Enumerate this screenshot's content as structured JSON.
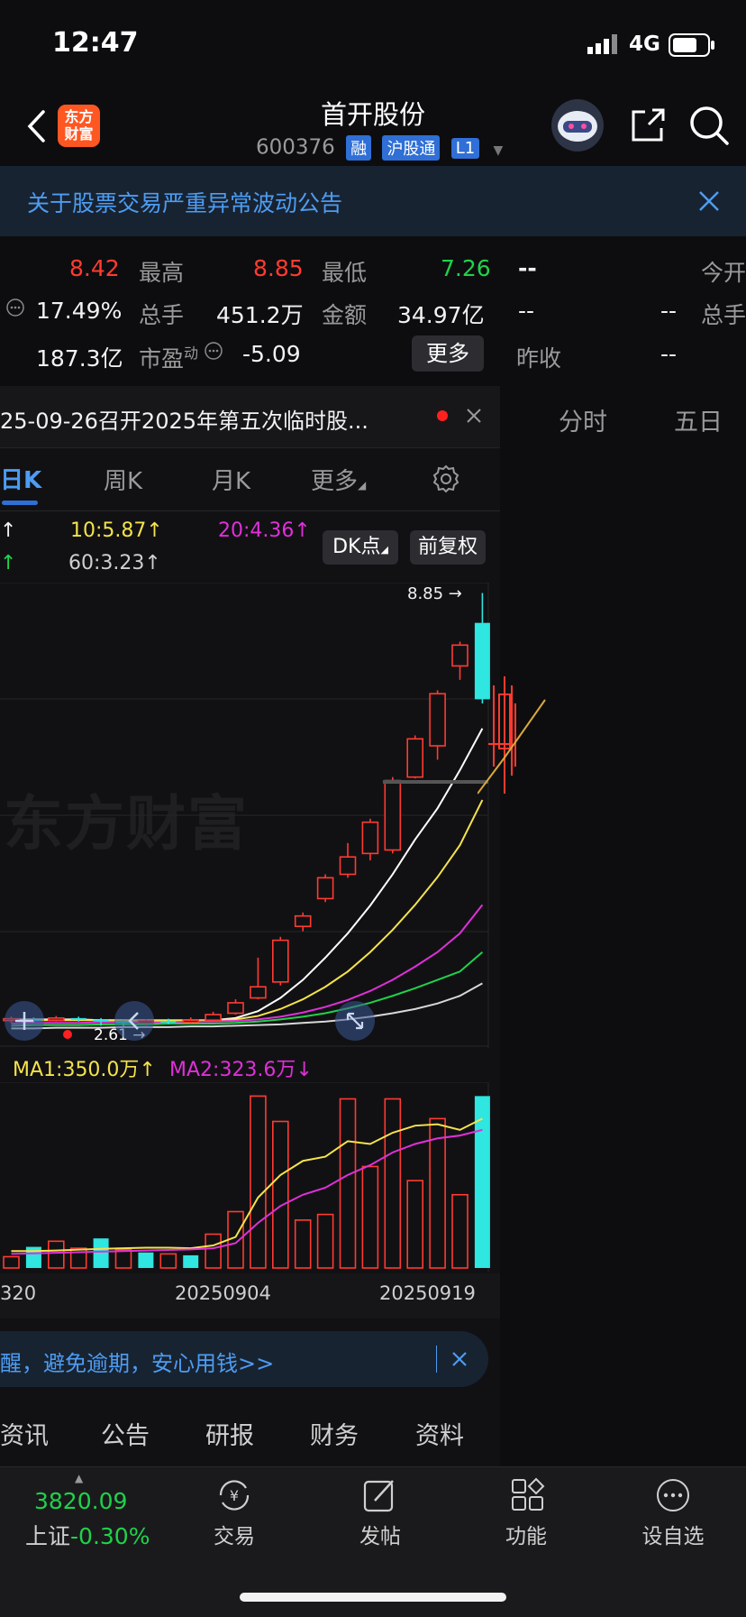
{
  "status_bar": {
    "time": "12:47",
    "network": "4G"
  },
  "header": {
    "logo_text": "东方\n财富",
    "title": "首开股份",
    "code": "600376",
    "badges": [
      "融",
      "沪股通",
      "L1"
    ]
  },
  "notice": {
    "text": "关于股票交易严重异常波动公告"
  },
  "quote": {
    "row1": {
      "v1": "8.42",
      "l2": "最高",
      "v2": "8.85",
      "l3": "最低",
      "v3": "7.26",
      "v4": "--",
      "l5": "今开"
    },
    "row2": {
      "v1": "17.49%",
      "l2": "总手",
      "v2": "451.2万",
      "l3": "金额",
      "v3": "34.97亿",
      "v4": "--",
      "v5": "--",
      "l6": "总手"
    },
    "row3": {
      "v1": "187.3亿",
      "l2": "市盈",
      "l2_sup": "动",
      "v2": "-5.09",
      "more": "更多",
      "l4": "昨收",
      "v4": "--"
    }
  },
  "event": {
    "text": "25-09-26召开2025年第五次临时股..."
  },
  "right_tabs": [
    "分时",
    "五日"
  ],
  "period_tabs": [
    "日K",
    "周K",
    "月K",
    "更多"
  ],
  "ma_legend": {
    "ma10": "10:5.87",
    "ma20": "20:4.36",
    "ma60": "60:3.23",
    "arrow_up": "↑"
  },
  "chart_buttons": {
    "dk": "DK点",
    "adj": "前复权"
  },
  "watermark": "东方财富",
  "kline_labels": {
    "high": "8.85",
    "low": "2.61"
  },
  "volume_legend": {
    "ma1": "MA1:350.0万",
    "ma1_arrow": "↑",
    "ma2": "MA2:323.6万",
    "ma2_arrow": "↓"
  },
  "date_axis": [
    "320",
    "20250904",
    "20250919"
  ],
  "banner": {
    "text": "醒，避免逾期，安心用钱>>"
  },
  "info_tabs": [
    "资讯",
    "公告",
    "研报",
    "财务",
    "资料"
  ],
  "bottom_nav": {
    "index_value": "3820.09",
    "index_name": "上证",
    "index_change": "-0.30%",
    "items": [
      "交易",
      "发帖",
      "功能",
      "设自选"
    ]
  },
  "chart_data": {
    "type": "candlestick",
    "price_range": [
      2.3,
      9.0
    ],
    "candles": [
      {
        "o": 2.7,
        "c": 2.72,
        "h": 2.75,
        "l": 2.66,
        "up": true
      },
      {
        "o": 2.71,
        "c": 2.7,
        "h": 2.74,
        "l": 2.67,
        "up": false
      },
      {
        "o": 2.7,
        "c": 2.73,
        "h": 2.76,
        "l": 2.68,
        "up": true
      },
      {
        "o": 2.73,
        "c": 2.71,
        "h": 2.75,
        "l": 2.68,
        "up": false
      },
      {
        "o": 2.71,
        "c": 2.68,
        "h": 2.73,
        "l": 2.62,
        "up": false
      },
      {
        "o": 2.68,
        "c": 2.66,
        "h": 2.7,
        "l": 2.61,
        "up": false
      },
      {
        "o": 2.66,
        "c": 2.69,
        "h": 2.71,
        "l": 2.62,
        "up": true
      },
      {
        "o": 2.69,
        "c": 2.67,
        "h": 2.72,
        "l": 2.64,
        "up": false
      },
      {
        "o": 2.67,
        "c": 2.7,
        "h": 2.74,
        "l": 2.65,
        "up": true
      },
      {
        "o": 2.7,
        "c": 2.78,
        "h": 2.82,
        "l": 2.69,
        "up": true
      },
      {
        "o": 2.8,
        "c": 2.95,
        "h": 3.0,
        "l": 2.78,
        "up": true
      },
      {
        "o": 3.02,
        "c": 3.18,
        "h": 3.6,
        "l": 3.0,
        "up": true
      },
      {
        "o": 3.25,
        "c": 3.85,
        "h": 3.9,
        "l": 3.2,
        "up": true
      },
      {
        "o": 4.05,
        "c": 4.2,
        "h": 4.25,
        "l": 3.98,
        "up": true
      },
      {
        "o": 4.45,
        "c": 4.75,
        "h": 4.8,
        "l": 4.4,
        "up": true
      },
      {
        "o": 4.8,
        "c": 5.05,
        "h": 5.25,
        "l": 4.75,
        "up": true
      },
      {
        "o": 5.1,
        "c": 5.55,
        "h": 5.6,
        "l": 5.0,
        "up": true
      },
      {
        "o": 5.15,
        "c": 6.15,
        "h": 6.2,
        "l": 5.1,
        "up": true
      },
      {
        "o": 6.2,
        "c": 6.75,
        "h": 6.8,
        "l": 6.18,
        "up": true
      },
      {
        "o": 6.65,
        "c": 7.4,
        "h": 7.45,
        "l": 6.45,
        "up": true
      },
      {
        "o": 7.8,
        "c": 8.1,
        "h": 8.15,
        "l": 7.6,
        "up": true
      },
      {
        "o": 8.42,
        "c": 7.32,
        "h": 8.85,
        "l": 7.26,
        "up": false
      }
    ],
    "ma_lines": [
      {
        "name": "MA5",
        "color": "#ffffff",
        "values": [
          2.71,
          2.71,
          2.71,
          2.71,
          2.7,
          2.7,
          2.69,
          2.68,
          2.68,
          2.7,
          2.73,
          2.83,
          3.02,
          3.28,
          3.6,
          3.95,
          4.35,
          4.8,
          5.3,
          5.75,
          6.3,
          6.9
        ]
      },
      {
        "name": "MA10",
        "color": "#f5e34b",
        "values": [
          2.7,
          2.7,
          2.7,
          2.7,
          2.7,
          2.7,
          2.7,
          2.7,
          2.7,
          2.7,
          2.71,
          2.76,
          2.86,
          3.0,
          3.18,
          3.4,
          3.68,
          4.0,
          4.36,
          4.76,
          5.22,
          5.87
        ]
      },
      {
        "name": "MA20",
        "color": "#e030d8",
        "values": [
          2.65,
          2.66,
          2.66,
          2.66,
          2.67,
          2.67,
          2.67,
          2.67,
          2.68,
          2.68,
          2.69,
          2.71,
          2.75,
          2.81,
          2.89,
          2.99,
          3.12,
          3.28,
          3.47,
          3.68,
          3.95,
          4.36
        ]
      },
      {
        "name": "MA30",
        "color": "#1fd24a",
        "values": [
          2.62,
          2.63,
          2.63,
          2.63,
          2.64,
          2.64,
          2.64,
          2.65,
          2.65,
          2.65,
          2.66,
          2.68,
          2.71,
          2.75,
          2.8,
          2.87,
          2.95,
          3.05,
          3.16,
          3.28,
          3.4,
          3.68
        ]
      },
      {
        "name": "MA60",
        "color": "#d8d8d8",
        "values": [
          2.58,
          2.58,
          2.59,
          2.59,
          2.59,
          2.6,
          2.6,
          2.6,
          2.61,
          2.61,
          2.62,
          2.63,
          2.64,
          2.66,
          2.68,
          2.71,
          2.75,
          2.8,
          2.86,
          2.94,
          3.05,
          3.23
        ]
      }
    ],
    "volume_range": [
      0,
      640
    ],
    "volumes": [
      {
        "v": 40,
        "up": true
      },
      {
        "v": 75,
        "up": false
      },
      {
        "v": 95,
        "up": true
      },
      {
        "v": 70,
        "up": true
      },
      {
        "v": 105,
        "up": false
      },
      {
        "v": 65,
        "up": true
      },
      {
        "v": 55,
        "up": false
      },
      {
        "v": 50,
        "up": true
      },
      {
        "v": 45,
        "up": false
      },
      {
        "v": 120,
        "up": true
      },
      {
        "v": 200,
        "up": true
      },
      {
        "v": 610,
        "up": true
      },
      {
        "v": 520,
        "up": true
      },
      {
        "v": 170,
        "up": true
      },
      {
        "v": 190,
        "up": true
      },
      {
        "v": 600,
        "up": true
      },
      {
        "v": 360,
        "up": true
      },
      {
        "v": 600,
        "up": true
      },
      {
        "v": 310,
        "up": true
      },
      {
        "v": 530,
        "up": true
      },
      {
        "v": 260,
        "up": true
      },
      {
        "v": 610,
        "up": false
      }
    ],
    "vol_ma1": [
      60,
      60,
      62,
      65,
      68,
      70,
      72,
      72,
      70,
      80,
      110,
      250,
      330,
      380,
      395,
      450,
      440,
      480,
      505,
      510,
      490,
      530
    ],
    "vol_ma2": [
      50,
      52,
      54,
      56,
      58,
      60,
      62,
      64,
      66,
      70,
      88,
      160,
      220,
      260,
      285,
      330,
      365,
      410,
      440,
      460,
      470,
      490
    ]
  }
}
